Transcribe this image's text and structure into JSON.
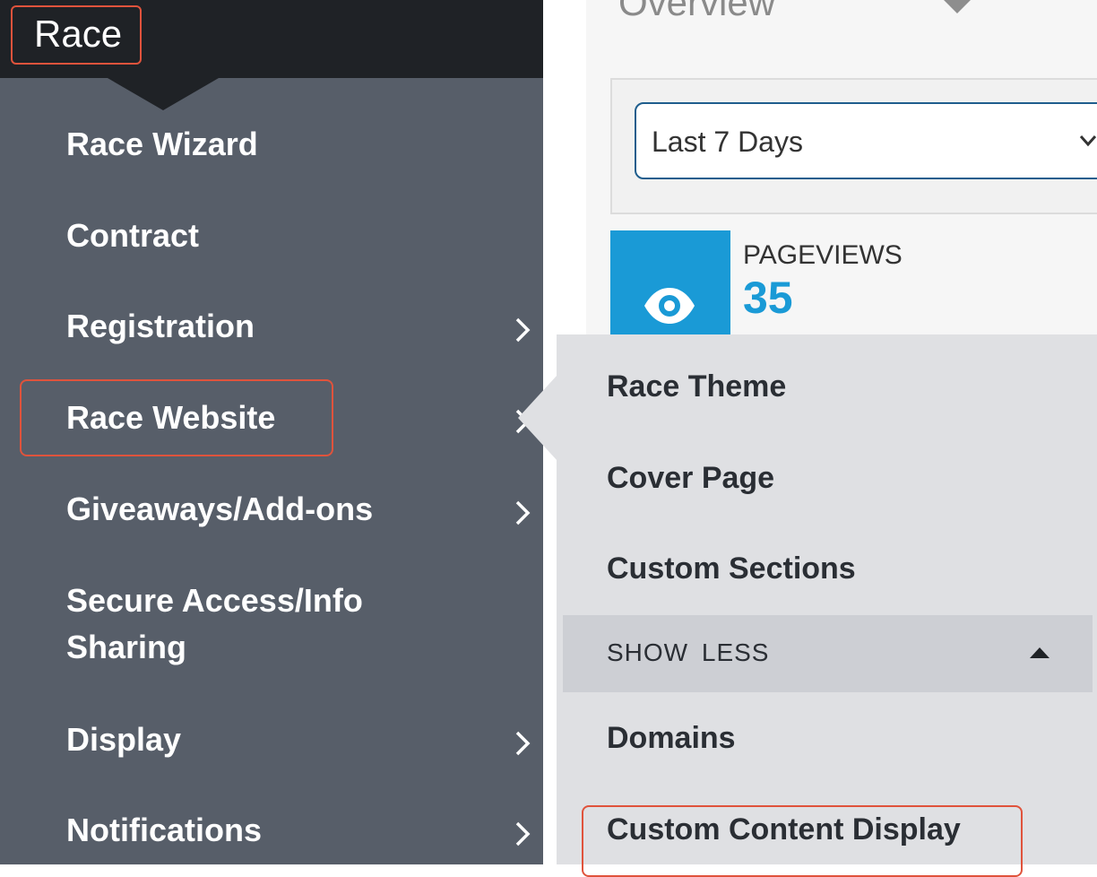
{
  "sidebar": {
    "title": "Race",
    "items": [
      {
        "label": "Race Wizard",
        "has_submenu": false
      },
      {
        "label": "Contract",
        "has_submenu": false
      },
      {
        "label": "Registration",
        "has_submenu": true
      },
      {
        "label": "Race Website",
        "has_submenu": true,
        "selected": true
      },
      {
        "label": "Giveaways/Add-ons",
        "has_submenu": true
      },
      {
        "label": "Secure Access/Info",
        "label_line2": "Sharing",
        "has_submenu": false
      },
      {
        "label": "Display",
        "has_submenu": true
      },
      {
        "label": "Notifications",
        "has_submenu": true
      }
    ]
  },
  "main": {
    "title": "Overview",
    "date_range": {
      "selected": "Last 7 Days"
    },
    "stat": {
      "label": "PAGEVIEWS",
      "value": "35",
      "icon": "eye-icon"
    }
  },
  "submenu": {
    "items": [
      {
        "label": "Race Theme"
      },
      {
        "label": "Cover Page"
      },
      {
        "label": "Custom Sections"
      }
    ],
    "toggle_label": "SHOW LESS",
    "more_items": [
      {
        "label": "Domains"
      },
      {
        "label": "Custom Content Display",
        "highlighted": true
      }
    ]
  },
  "colors": {
    "sidebar_bg": "#575e69",
    "header_bg": "#1f2226",
    "submenu_bg": "#dfe0e3",
    "accent_blue": "#1a9ad6",
    "highlight_outline": "#e0533c"
  }
}
